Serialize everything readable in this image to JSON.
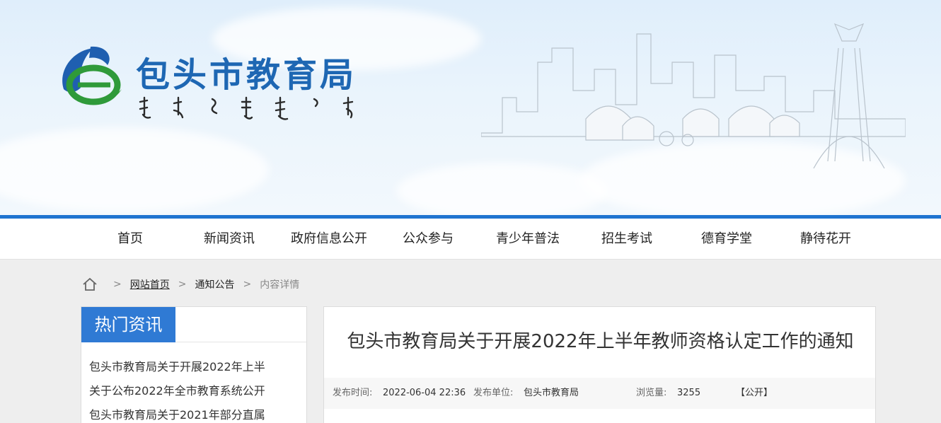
{
  "header": {
    "site_title": "包头市教育局"
  },
  "nav": {
    "items": [
      "首页",
      "新闻资讯",
      "政府信息公开",
      "公众参与",
      "青少年普法",
      "招生考试",
      "德育学堂",
      "静待花开"
    ]
  },
  "breadcrumb": {
    "home_icon": "home-icon",
    "separator": ">",
    "site_home": "网站首页",
    "section": "通知公告",
    "current": "内容详情"
  },
  "sidebar": {
    "heading": "热门资讯",
    "items": [
      "包头市教育局关于开展2022年上半",
      "关于公布2022年全市教育系统公开",
      "包头市教育局关于2021年部分直属"
    ]
  },
  "article": {
    "title": "包头市教育局关于开展2022年上半年教师资格认定工作的通知",
    "meta": {
      "date_label": "发布时间:",
      "date_value": "2022-06-04 22:36",
      "unit_label": "发布单位:",
      "unit_value": "包头市教育局",
      "views_label": "浏览量:",
      "views_value": "3255",
      "open_tag": "【公开】"
    }
  },
  "colors": {
    "brand_blue": "#1e67b3",
    "nav_bar": "#1f74d0",
    "sidebar_tab": "#2f7ad4"
  }
}
